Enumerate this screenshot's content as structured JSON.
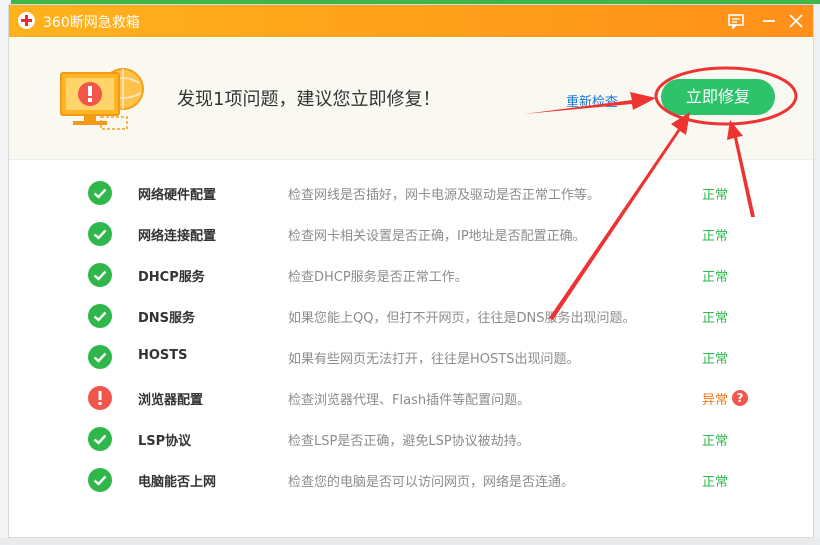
{
  "window": {
    "title": "360断网急救箱"
  },
  "titlebar": {
    "feedback_icon": "feedback-icon",
    "minimize_icon": "minimize-icon",
    "close_icon": "close-icon"
  },
  "header": {
    "headline": "发现1项问题，建议您立即修复！",
    "recheck_label": "重新检查",
    "fix_label": "立即修复"
  },
  "items": [
    {
      "name": "网络硬件配置",
      "desc": "检查网线是否插好，网卡电源及驱动是否正常工作等。",
      "status": "正常",
      "state": "ok"
    },
    {
      "name": "网络连接配置",
      "desc": "检查网卡相关设置是否正确，IP地址是否配置正确。",
      "status": "正常",
      "state": "ok"
    },
    {
      "name": "DHCP服务",
      "desc": "检查DHCP服务是否正常工作。",
      "status": "正常",
      "state": "ok"
    },
    {
      "name": "DNS服务",
      "desc": "如果您能上QQ，但打不开网页，往往是DNS服务出现问题。",
      "status": "正常",
      "state": "ok"
    },
    {
      "name": "HOSTS",
      "desc": "如果有些网页无法打开，往往是HOSTS出现问题。",
      "status": "正常",
      "state": "ok"
    },
    {
      "name": "浏览器配置",
      "desc": "检查浏览器代理、Flash插件等配置问题。",
      "status": "异常",
      "state": "err",
      "help": "?"
    },
    {
      "name": "LSP协议",
      "desc": "检查LSP是否正确，避免LSP协议被劫持。",
      "status": "正常",
      "state": "ok"
    },
    {
      "name": "电脑能否上网",
      "desc": "检查您的电脑是否可以访问网页，网络是否连通。",
      "status": "正常",
      "state": "ok"
    }
  ],
  "colors": {
    "accent_orange": "#ff9e1a",
    "ok_green": "#2fb74c",
    "err_red": "#f2554a",
    "fix_button": "#2ec26b",
    "annotation_red": "#ee3333"
  }
}
